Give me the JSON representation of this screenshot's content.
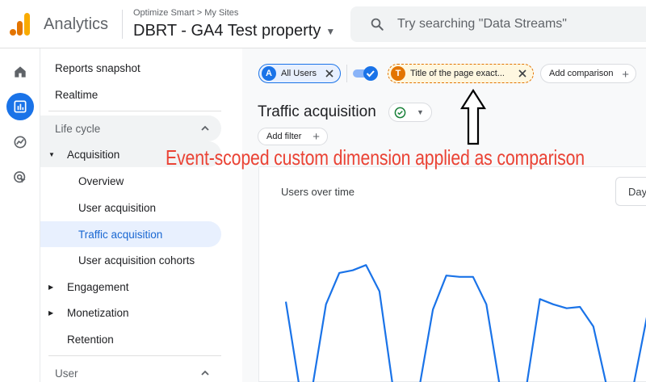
{
  "header": {
    "app_name": "Analytics",
    "breadcrumb": {
      "account": "Optimize Smart",
      "separator": ">",
      "section": "My Sites"
    },
    "property": "DBRT - GA4 Test property",
    "search_placeholder": "Try searching \"Data Streams\""
  },
  "rail": {
    "icons": [
      "home-icon",
      "reports-icon",
      "explore-icon",
      "advertising-icon"
    ],
    "active": "reports-icon"
  },
  "sidebar": {
    "reports_snapshot": "Reports snapshot",
    "realtime": "Realtime",
    "lifecycle": "Life cycle",
    "acquisition": "Acquisition",
    "overview": "Overview",
    "user_acquisition": "User acquisition",
    "traffic_acquisition": "Traffic acquisition",
    "user_acquisition_cohorts": "User acquisition cohorts",
    "engagement": "Engagement",
    "monetization": "Monetization",
    "retention": "Retention",
    "user": "User"
  },
  "comparisons": {
    "all_users": {
      "avatar": "A",
      "label": "All Users",
      "color": "#1a73e8"
    },
    "toggle_on": true,
    "title_filter": {
      "avatar": "T",
      "label": "Title of the page exact...",
      "color": "#e37400"
    },
    "add_comparison": "Add comparison"
  },
  "main": {
    "page_title": "Traffic acquisition",
    "add_filter": "Add filter",
    "card_title": "Users over time",
    "range_button": "Day"
  },
  "annotation": {
    "text": "Event-scoped custom dimension applied as comparison",
    "color": "#ea4335"
  },
  "chart_data": {
    "type": "line",
    "title": "Users over time",
    "series": [
      {
        "color": "#1a73e8",
        "values": [
          0.62,
          0.0,
          0.0,
          0.6,
          0.84,
          0.86,
          0.9,
          0.7,
          0.0,
          0.0,
          0.0,
          0.56,
          0.82,
          0.81,
          0.81,
          0.6,
          0.0,
          0.0,
          0.0,
          0.64,
          0.6,
          0.57,
          0.58,
          0.43,
          0.0,
          0.0,
          0.0,
          0.5
        ]
      }
    ]
  }
}
